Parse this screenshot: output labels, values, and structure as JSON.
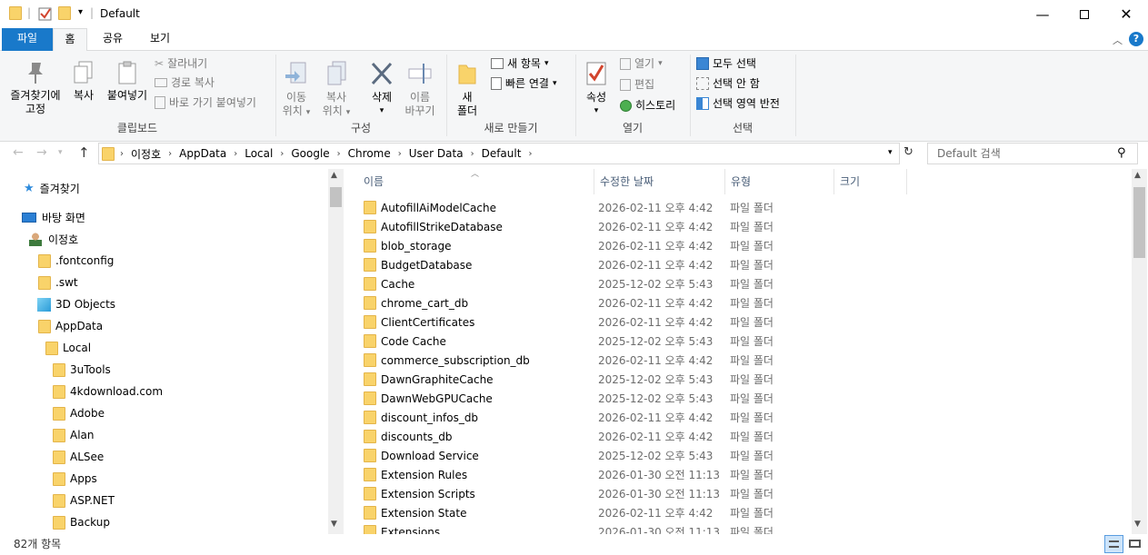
{
  "window": {
    "title": "Default"
  },
  "tabs": {
    "file": "파일",
    "home": "홈",
    "share": "공유",
    "view": "보기"
  },
  "ribbon": {
    "clipboard": {
      "pin": "즐겨찾기에\n고정",
      "pin_line1": "즐겨찾기에",
      "pin_line2": "고정",
      "copy": "복사",
      "paste": "붙여넣기",
      "cut": "잘라내기",
      "copy_path": "경로 복사",
      "paste_shortcut": "바로 가기 붙여넣기",
      "label": "클립보드"
    },
    "organize": {
      "move_to_1": "이동",
      "move_to_2": "위치",
      "copy_to_1": "복사",
      "copy_to_2": "위치",
      "delete": "삭제",
      "rename_1": "이름",
      "rename_2": "바꾸기",
      "label": "구성"
    },
    "new": {
      "new_folder_1": "새",
      "new_folder_2": "폴더",
      "new_item": "새 항목",
      "easy_access": "빠른 연결",
      "label": "새로 만들기"
    },
    "open": {
      "properties": "속성",
      "open": "열기",
      "edit": "편집",
      "history": "히스토리",
      "label": "열기"
    },
    "select": {
      "select_all": "모두 선택",
      "select_none": "선택 안 함",
      "invert": "선택 영역 반전",
      "label": "선택"
    }
  },
  "address": {
    "crumbs": [
      "이정호",
      "AppData",
      "Local",
      "Google",
      "Chrome",
      "User Data",
      "Default"
    ],
    "search_placeholder": "Default 검색"
  },
  "nav": {
    "quick_access": "즐겨찾기",
    "desktop": "바탕 화면",
    "user": "이정호",
    "items": [
      ".fontconfig",
      ".swt",
      "3D Objects",
      "AppData",
      "Local",
      "3uTools",
      "4kdownload.com",
      "Adobe",
      "Alan",
      "ALSee",
      "Apps",
      "ASP.NET",
      "Backup"
    ]
  },
  "columns": {
    "name": "이름",
    "modified": "수정한 날짜",
    "type": "유형",
    "size": "크기"
  },
  "files": [
    {
      "name": "AutofillAiModelCache",
      "date": "2026-02-11 오후 4:42",
      "type": "파일 폴더"
    },
    {
      "name": "AutofillStrikeDatabase",
      "date": "2026-02-11 오후 4:42",
      "type": "파일 폴더"
    },
    {
      "name": "blob_storage",
      "date": "2026-02-11 오후 4:42",
      "type": "파일 폴더"
    },
    {
      "name": "BudgetDatabase",
      "date": "2026-02-11 오후 4:42",
      "type": "파일 폴더"
    },
    {
      "name": "Cache",
      "date": "2025-12-02 오후 5:43",
      "type": "파일 폴더"
    },
    {
      "name": "chrome_cart_db",
      "date": "2026-02-11 오후 4:42",
      "type": "파일 폴더"
    },
    {
      "name": "ClientCertificates",
      "date": "2026-02-11 오후 4:42",
      "type": "파일 폴더"
    },
    {
      "name": "Code Cache",
      "date": "2025-12-02 오후 5:43",
      "type": "파일 폴더"
    },
    {
      "name": "commerce_subscription_db",
      "date": "2026-02-11 오후 4:42",
      "type": "파일 폴더"
    },
    {
      "name": "DawnGraphiteCache",
      "date": "2025-12-02 오후 5:43",
      "type": "파일 폴더"
    },
    {
      "name": "DawnWebGPUCache",
      "date": "2025-12-02 오후 5:43",
      "type": "파일 폴더"
    },
    {
      "name": "discount_infos_db",
      "date": "2026-02-11 오후 4:42",
      "type": "파일 폴더"
    },
    {
      "name": "discounts_db",
      "date": "2026-02-11 오후 4:42",
      "type": "파일 폴더"
    },
    {
      "name": "Download Service",
      "date": "2025-12-02 오후 5:43",
      "type": "파일 폴더"
    },
    {
      "name": "Extension Rules",
      "date": "2026-01-30 오전 11:13",
      "type": "파일 폴더"
    },
    {
      "name": "Extension Scripts",
      "date": "2026-01-30 오전 11:13",
      "type": "파일 폴더"
    },
    {
      "name": "Extension State",
      "date": "2026-02-11 오후 4:42",
      "type": "파일 폴더"
    },
    {
      "name": "Extensions",
      "date": "2026-01-30 오전 11:13",
      "type": "파일 폴더"
    }
  ],
  "status": {
    "count": "82개 항목"
  }
}
